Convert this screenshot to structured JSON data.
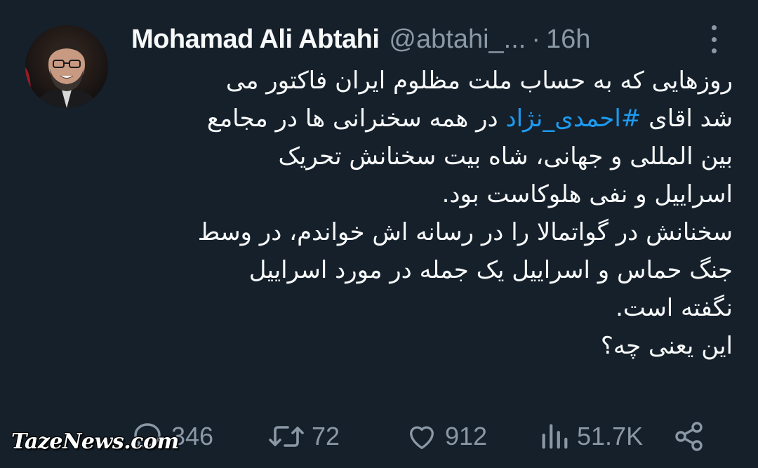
{
  "author": {
    "display_name": "Mohamad Ali Abtahi",
    "handle": "@abtahi_...",
    "separator": "·",
    "time": "16h"
  },
  "tweet": {
    "lines": [
      "روزهایی که به حساب ملت مظلوم ایران فاکتور می",
      "بین المللی و جهانی، شاه بیت سخنانش تحریک",
      "اسراییل و نفی هلوکاست بود.",
      "سخنانش در گواتمالا را در رسانه اش خواندم، در وسط",
      "جنگ حماس و اسراییل یک جمله در مورد اسراییل",
      "نگفته است.",
      "این یعنی چه؟"
    ],
    "line2_prefix": "شد اقای",
    "hashtag": "#احمدی_نژاد",
    "line2_suffix": "در همه  سخنرانی ها در مجامع"
  },
  "actions": {
    "reply_count": "346",
    "retweet_count": "72",
    "like_count": "912",
    "views_count": "51.7K"
  },
  "icons": {
    "reply": "reply-icon",
    "retweet": "retweet-icon",
    "like": "heart-icon",
    "views": "views-icon",
    "share": "share-icon",
    "more": "more-icon"
  },
  "colors": {
    "background": "#15202b",
    "text": "#f7f9f9",
    "muted": "#8b98a5",
    "link": "#1d9bf0"
  },
  "watermark": "TazeNews.com"
}
